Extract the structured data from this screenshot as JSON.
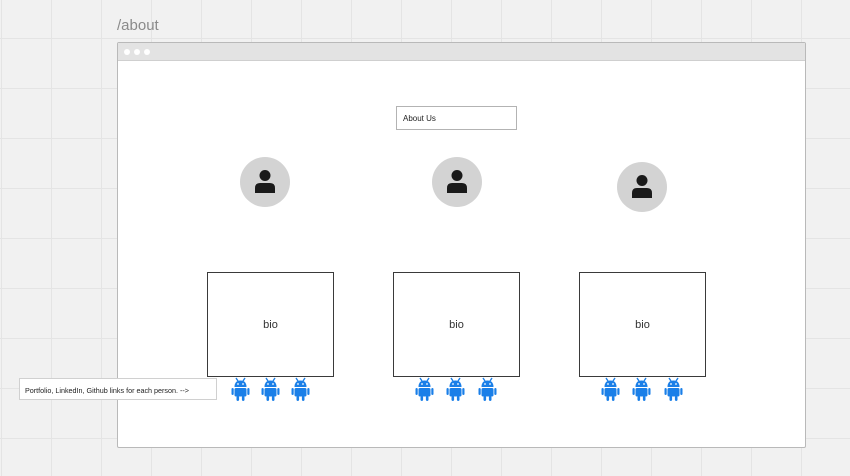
{
  "route": "/about",
  "heading": "About Us",
  "people": [
    {
      "bio": "bio",
      "links": [
        "android-icon",
        "android-icon",
        "android-icon"
      ]
    },
    {
      "bio": "bio",
      "links": [
        "android-icon",
        "android-icon",
        "android-icon"
      ]
    },
    {
      "bio": "bio",
      "links": [
        "android-icon",
        "android-icon",
        "android-icon"
      ]
    }
  ],
  "note": "Portfolio, LinkedIn, Github links  for each person. -->",
  "colors": {
    "canvas": "#f1f1f1",
    "frame": "#ffffff",
    "titlebar": "#e3e3e3",
    "avatar_bg": "#d3d3d3",
    "avatar_fg": "#1a1a1a",
    "link_icon": "#1a7fe8"
  }
}
